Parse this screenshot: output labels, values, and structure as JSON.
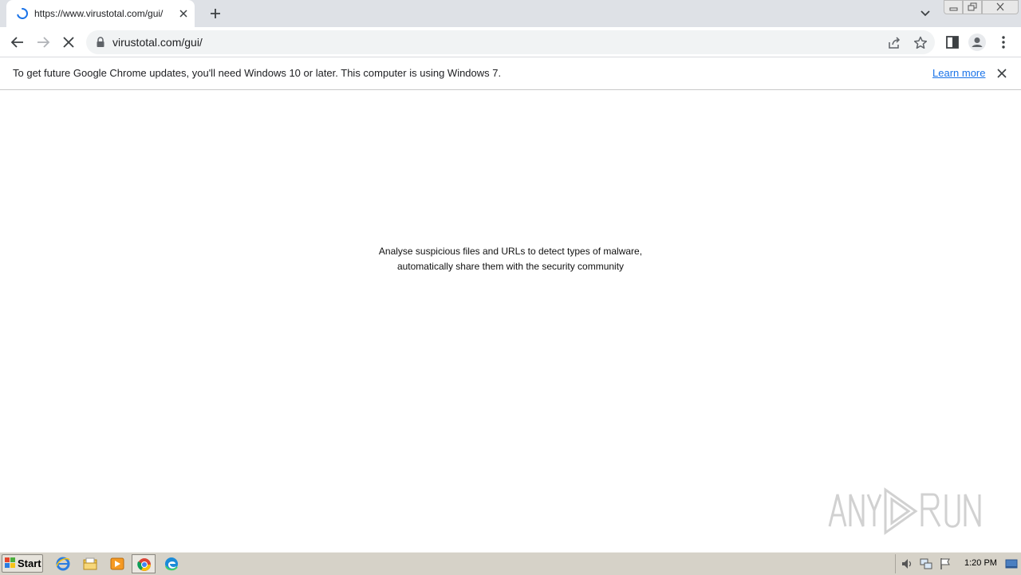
{
  "browser": {
    "tab": {
      "title": "https://www.virustotal.com/gui/",
      "state": "loading"
    },
    "url": "virustotal.com/gui/",
    "icons": {
      "back": "arrow-left-icon",
      "forward": "arrow-right-icon",
      "stop": "close-icon",
      "lock": "lock-icon",
      "share": "share-icon",
      "bookmark": "star-icon",
      "side_panel": "side-panel-icon",
      "profile": "profile-icon",
      "menu": "kebab-menu-icon"
    }
  },
  "infobar": {
    "message": "To get future Google Chrome updates, you'll need Windows 10 or later. This computer is using Windows 7.",
    "link": "Learn more"
  },
  "page": {
    "tagline_line1": "Analyse suspicious files and URLs to detect types of malware,",
    "tagline_line2": "automatically share them with the security community"
  },
  "watermark": "ANY RUN",
  "taskbar": {
    "start_label": "Start",
    "apps": [
      "internet-explorer-icon",
      "file-explorer-icon",
      "media-player-icon",
      "chrome-icon",
      "edge-icon"
    ],
    "active_app": "chrome-icon",
    "clock": "1:20 PM"
  },
  "colors": {
    "link": "#1a73e8",
    "tabstrip": "#dee1e6",
    "taskbar": "#d6d2c8"
  }
}
